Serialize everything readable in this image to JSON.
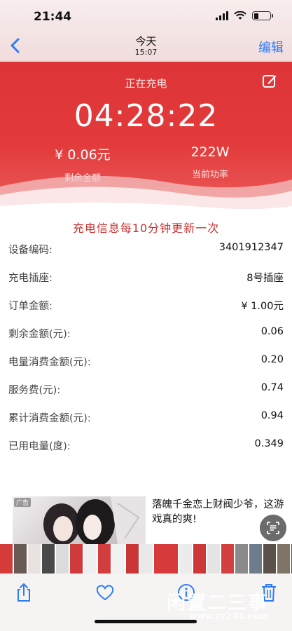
{
  "status_bar": {
    "time": "21:44"
  },
  "nav": {
    "title": "今天",
    "subtitle": "15:07",
    "edit_label": "编辑"
  },
  "charge": {
    "status": "正在充电",
    "timer": "04:28:22",
    "remaining_value": "¥ 0.06元",
    "remaining_label": "剩余金额",
    "power_value": "222W",
    "power_label": "当前功率"
  },
  "notice": "充电信息每10分钟更新一次",
  "details": [
    {
      "label": "设备编码:",
      "value": "3401912347"
    },
    {
      "label": "充电插座:",
      "value": "8号插座"
    },
    {
      "label": "订单金额:",
      "value": "¥ 1.00元"
    },
    {
      "label": "剩余金额(元):",
      "value": "0.06"
    },
    {
      "label": "电量消费金额(元):",
      "value": "0.20"
    },
    {
      "label": "服务费(元):",
      "value": "0.74"
    },
    {
      "label": "累计消费金额(元):",
      "value": "0.94"
    },
    {
      "label": "已用电量(度):",
      "value": "0.349"
    }
  ],
  "ad": {
    "tag": "广告",
    "text": "落魄千金恋上财阀少爷，这游戏真的爽!"
  },
  "toolbar": {
    "share_icon": "share-icon",
    "favorite_icon": "heart-icon",
    "info_icon": "info-icon",
    "delete_icon": "trash-icon"
  },
  "watermark": {
    "text": "闲置二三事",
    "url": "www.zy234.com"
  },
  "colors": {
    "header_red": "#e23a3b",
    "notice_red": "#c8302f",
    "ios_blue": "#2d7cf6"
  }
}
